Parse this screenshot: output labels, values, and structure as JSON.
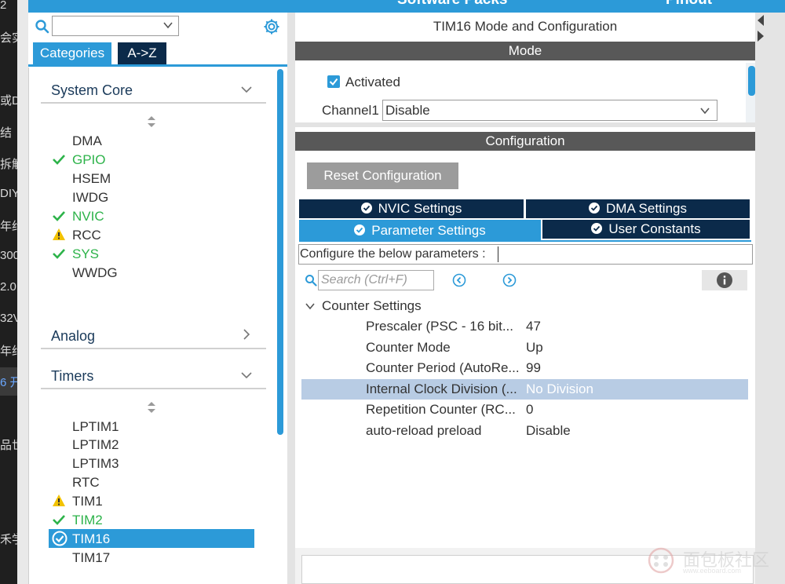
{
  "strip_glyphs": [
    "2",
    "会实",
    "或D",
    "结",
    "拆解",
    "DIY",
    "年约",
    "300",
    "2.0",
    "32V",
    "年约",
    "6 开",
    "品世",
    "禾学"
  ],
  "top_header": {
    "left_text": "Software Packs",
    "right_text": "Pinout"
  },
  "left_panel": {
    "search_value": "",
    "tabs": [
      "Categories",
      "A->Z"
    ],
    "system_core": {
      "label": "System Core",
      "items": [
        {
          "label": "DMA",
          "status": "none"
        },
        {
          "label": "GPIO",
          "status": "ok"
        },
        {
          "label": "HSEM",
          "status": "none"
        },
        {
          "label": "IWDG",
          "status": "none"
        },
        {
          "label": "NVIC",
          "status": "ok"
        },
        {
          "label": "RCC",
          "status": "warn"
        },
        {
          "label": "SYS",
          "status": "ok"
        },
        {
          "label": "WWDG",
          "status": "none"
        }
      ]
    },
    "analog": {
      "label": "Analog"
    },
    "timers": {
      "label": "Timers",
      "items": [
        {
          "label": "LPTIM1",
          "status": "none"
        },
        {
          "label": "LPTIM2",
          "status": "none"
        },
        {
          "label": "LPTIM3",
          "status": "none"
        },
        {
          "label": "RTC",
          "status": "none"
        },
        {
          "label": "TIM1",
          "status": "warn"
        },
        {
          "label": "TIM2",
          "status": "ok"
        },
        {
          "label": "TIM16",
          "status": "selected"
        },
        {
          "label": "TIM17",
          "status": "none"
        }
      ]
    }
  },
  "right_panel": {
    "title": "TIM16 Mode and Configuration",
    "mode_header": "Mode",
    "activated_label": "Activated",
    "activated_checked": true,
    "channel1_label": "Channel1",
    "channel1_value": "Disable",
    "config_header": "Configuration",
    "reset_button": "Reset Configuration",
    "tabs": {
      "nvic": "NVIC Settings",
      "dma": "DMA Settings",
      "param": "Parameter Settings",
      "user": "User Constants"
    },
    "configure_text": "Configure the below parameters :",
    "search_placeholder": "Search (Ctrl+F)",
    "counter_settings_label": "Counter Settings",
    "params": [
      {
        "name": "Prescaler (PSC - 16 bit...",
        "value": "47"
      },
      {
        "name": "Counter Mode",
        "value": "Up"
      },
      {
        "name": "Counter Period (AutoRe...",
        "value": "99"
      },
      {
        "name": "Internal Clock Division (...",
        "value": "No Division"
      },
      {
        "name": "Repetition Counter (RC...",
        "value": "0"
      },
      {
        "name": "auto-reload preload",
        "value": "Disable"
      }
    ]
  },
  "watermark": {
    "text": "面包板社区",
    "sub": "www.eeboard.com"
  },
  "colors": {
    "accent": "#2c9ad8",
    "navy": "#0b2a4a",
    "ok_green": "#2db34a",
    "warn_yellow": "#f2c200",
    "selected_row": "#b8cce4"
  }
}
